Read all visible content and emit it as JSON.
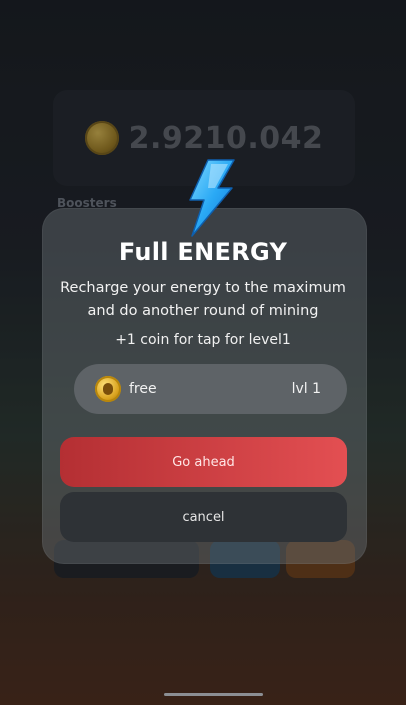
{
  "background": {
    "balance": "2.9210.042",
    "boosters_label": "Boosters"
  },
  "modal": {
    "icon": "lightning-bolt-icon",
    "title": "Full ENERGY",
    "description": "Recharge your energy to the maximum and do another round of mining",
    "bonus": "+1 coin for tap for level1",
    "price_label": "free",
    "level_label": "lvl 1",
    "primary_button": "Go ahead",
    "secondary_button": "cancel"
  },
  "colors": {
    "accent_red": "#e34f52",
    "bolt_blue": "#2aa9f5"
  }
}
